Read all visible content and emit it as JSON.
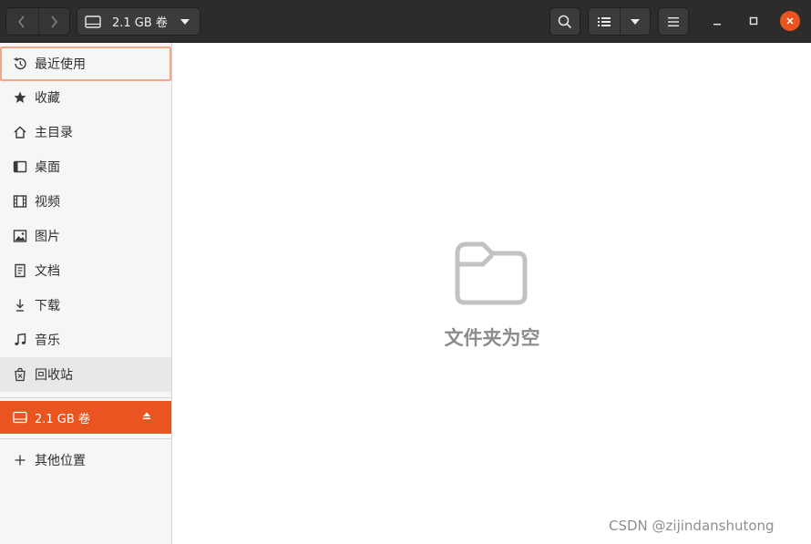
{
  "header": {
    "path_label": "2.1 GB 卷",
    "colors": {
      "headerbar": "#2c2c2c",
      "accent": "#e95420"
    }
  },
  "sidebar": {
    "items": [
      {
        "label": "最近使用",
        "icon": "recent-icon"
      },
      {
        "label": "收藏",
        "icon": "star-icon"
      },
      {
        "label": "主目录",
        "icon": "home-icon"
      },
      {
        "label": "桌面",
        "icon": "desktop-icon"
      },
      {
        "label": "视频",
        "icon": "video-icon"
      },
      {
        "label": "图片",
        "icon": "picture-icon"
      },
      {
        "label": "文档",
        "icon": "document-icon"
      },
      {
        "label": "下载",
        "icon": "download-icon"
      },
      {
        "label": "音乐",
        "icon": "music-icon"
      },
      {
        "label": "回收站",
        "icon": "trash-icon"
      }
    ],
    "volume": {
      "label": "2.1 GB 卷",
      "icon": "drive-icon"
    },
    "other_locations": {
      "label": "其他位置",
      "icon": "plus-icon"
    }
  },
  "main": {
    "empty_text": "文件夹为空",
    "empty_icon": "folder-icon"
  },
  "watermark": "CSDN @zijindanshutong"
}
